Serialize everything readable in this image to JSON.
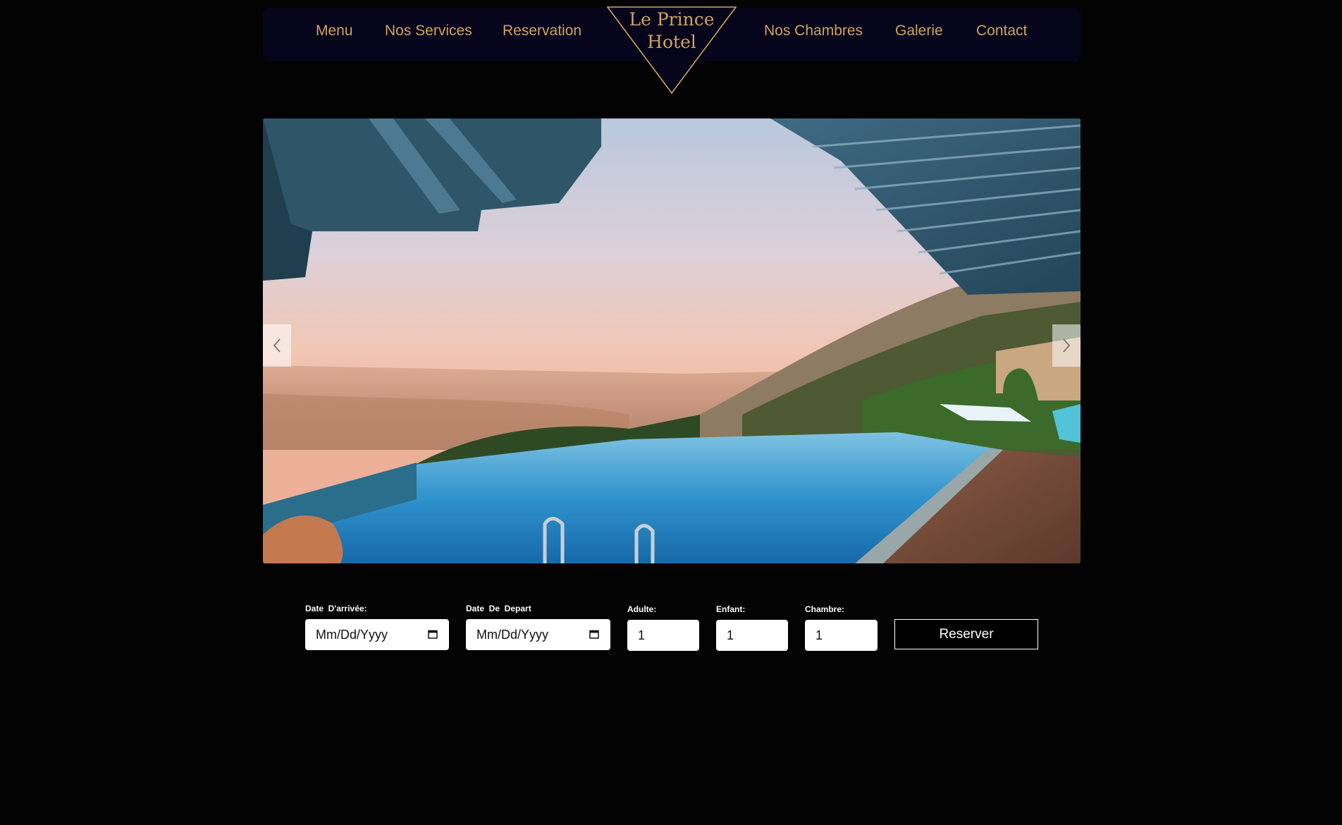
{
  "nav": {
    "links": [
      "Menu",
      "Nos Services",
      "Reservation",
      "Nos Chambres",
      "Galerie",
      "Contact"
    ],
    "logo_line1": "Le Prince",
    "logo_line2": "Hotel"
  },
  "carousel": {
    "prev_icon": "chevron-left-icon",
    "next_icon": "chevron-right-icon"
  },
  "booking": {
    "arrival_label": "Date  D'arrivée:",
    "departure_label": "Date  De  Depart",
    "arrival_value": "Mm/Dd/Yyyy",
    "departure_value": "Mm/Dd/Yyyy",
    "adults_label": "Adulte:",
    "children_label": "Enfant:",
    "rooms_label": "Chambre:",
    "adults_value": "1",
    "children_value": "1",
    "rooms_value": "1",
    "submit_label": "Reserver"
  },
  "colors": {
    "page_bg": "#030303",
    "nav_bg": "#07051b",
    "accent_gold": "#cfa462"
  }
}
